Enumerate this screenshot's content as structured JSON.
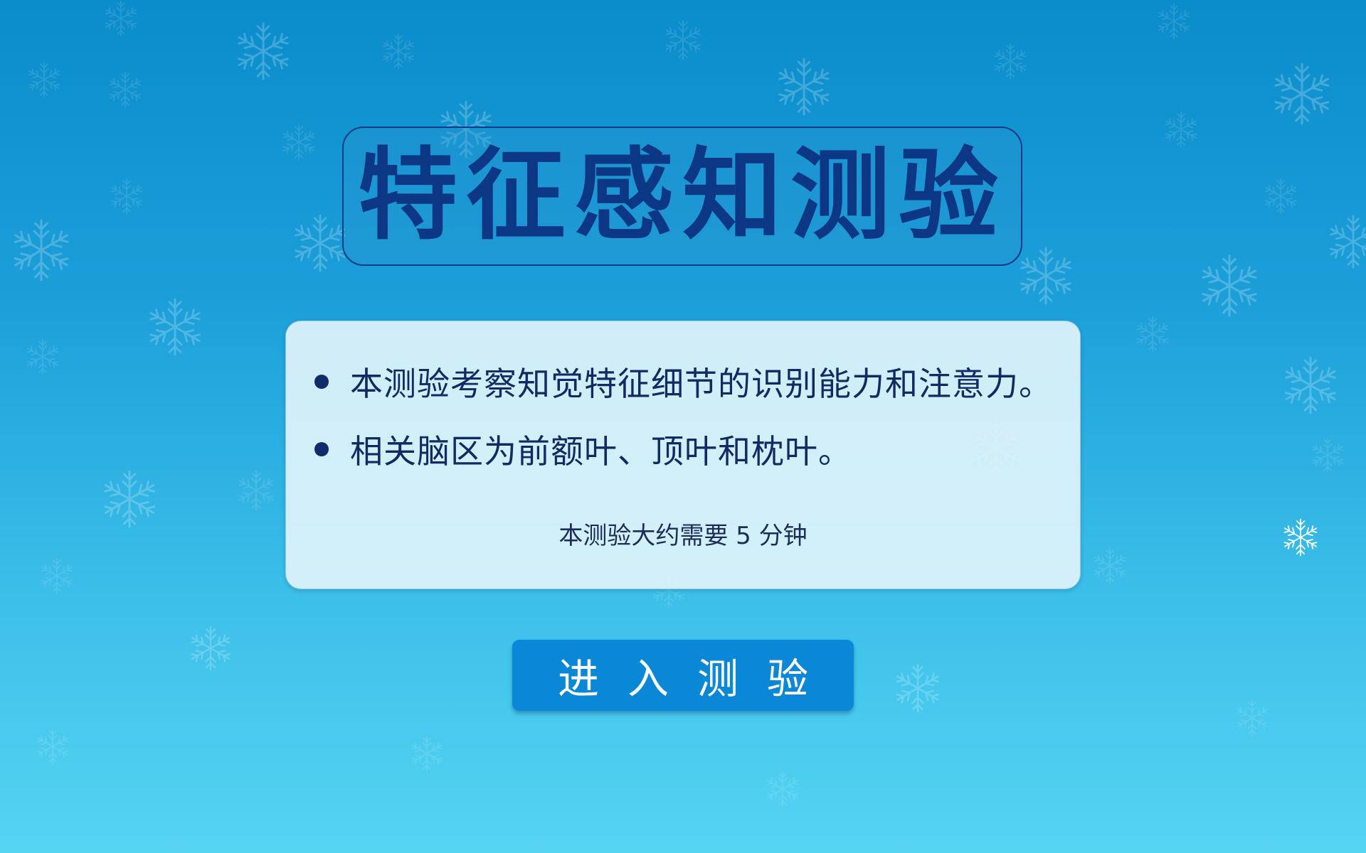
{
  "header": {
    "title": "特征感知测验"
  },
  "info": {
    "bullets": [
      "本测验考察知觉特征细节的识别能力和注意力。",
      "相关脑区为前额叶、顶叶和枕叶。"
    ],
    "duration": "本测验大约需要 5 分钟"
  },
  "actions": {
    "enter_label": "进入测验"
  },
  "theme": {
    "background_top": "#0b8ccb",
    "background_bottom": "#56d4f2",
    "title_color": "#0c3784",
    "button_color": "#0b87d8",
    "decoration_icon": "snowflake-icon"
  }
}
